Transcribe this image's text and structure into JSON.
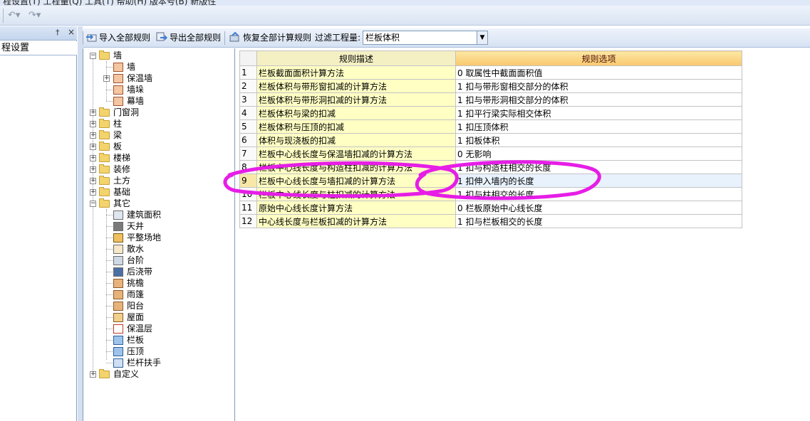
{
  "top_strip_fragment": "程设置(T)  工程量(Q)  工具(T)  帮助(H)  版本号(B)  新版性",
  "quick_access": {
    "undo_icon": "undo-icon",
    "redo_icon": "redo-icon"
  },
  "left_pane": {
    "nav_item": "程设置",
    "pin_glyph": "†",
    "close_glyph": "×"
  },
  "toolbar": {
    "import_label": "导入全部规则",
    "export_label": "导出全部规则",
    "restore_label": "恢复全部计算规则",
    "filter_label": "过滤工程量:",
    "filter_value": "栏板体积"
  },
  "tree": {
    "wall": "墙",
    "wall_children": [
      "墙",
      "保温墙",
      "墙垛",
      "幕墙"
    ],
    "groups": [
      "门窗洞",
      "柱",
      "梁",
      "板",
      "楼梯",
      "装修",
      "土方",
      "基础"
    ],
    "other": "其它",
    "other_children": [
      "建筑面积",
      "天井",
      "平整场地",
      "散水",
      "台阶",
      "后浇带",
      "挑檐",
      "雨篷",
      "阳台",
      "屋面",
      "保温层",
      "栏板",
      "压顶",
      "栏杆扶手"
    ],
    "custom": "自定义"
  },
  "grid": {
    "headers": {
      "desc": "规则描述",
      "option": "规则选项"
    },
    "rows": [
      {
        "no": "1",
        "desc": "栏板截面面积计算方法",
        "option": "0  取属性中截面面积值"
      },
      {
        "no": "2",
        "desc": "栏板体积与带形窗扣减的计算方法",
        "option": "1 扣与带形窗相交部分的体积"
      },
      {
        "no": "3",
        "desc": "栏板体积与带形洞扣减的计算方法",
        "option": "1 扣与带形洞相交部分的体积"
      },
      {
        "no": "4",
        "desc": "栏板体积与梁的扣减",
        "option": "1 扣平行梁实际相交体积"
      },
      {
        "no": "5",
        "desc": "栏板体积与压顶的扣减",
        "option": "1 扣压顶体积"
      },
      {
        "no": "6",
        "desc": "体积与现浇板的扣减",
        "option": "1 扣板体积"
      },
      {
        "no": "7",
        "desc": "栏板中心线长度与保温墙扣减的计算方法",
        "option": "0  无影响"
      },
      {
        "no": "8",
        "desc": "栏板中心线长度与构造柱扣减的计算方法",
        "option": "1 扣与构造柱相交的长度"
      },
      {
        "no": "9",
        "desc": "栏板中心线长度与墙扣减的计算方法",
        "option": "1 扣伸入墙内的长度"
      },
      {
        "no": "10",
        "desc": "栏板中心线长度与柱扣减的计算方法",
        "option": "1 扣与柱相交的长度"
      },
      {
        "no": "11",
        "desc": "原始中心线长度计算方法",
        "option": "0 栏板原始中心线长度"
      },
      {
        "no": "12",
        "desc": "中心线长度与栏板扣减的计算方法",
        "option": "1 扣与栏板相交的长度"
      }
    ],
    "selected_row": "9"
  },
  "colors": {
    "annotation": "#e61ee6",
    "header_option": "#f8c86e",
    "desc_cell": "#ffffc4"
  }
}
